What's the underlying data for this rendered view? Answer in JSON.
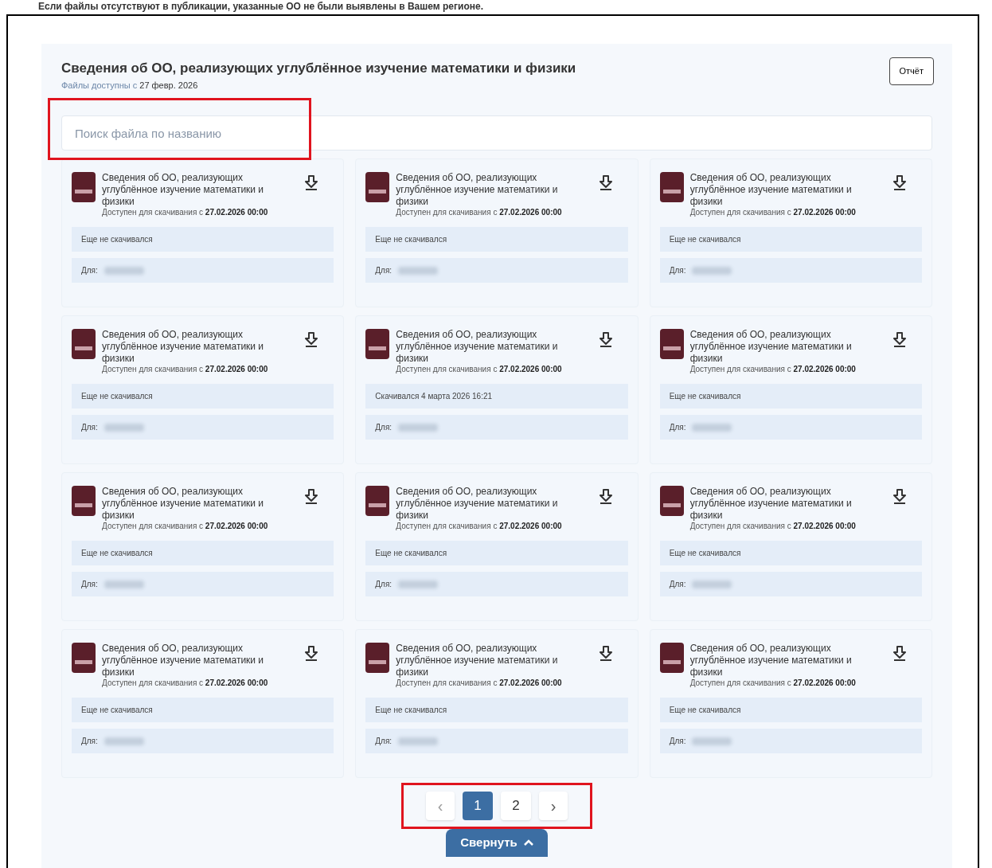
{
  "notice": "Если файлы отсутствуют в публикации, указанные ОО не были выявлены в Вашем регионе.",
  "section": {
    "title": "Сведения об ОО, реализующих углублённое изучение математики и физики",
    "subtitle_label": "Файлы доступны с",
    "subtitle_date": "27 февр. 2026",
    "report_button": "Отчёт"
  },
  "search": {
    "placeholder": "Поиск файла по названию",
    "highlighted": true
  },
  "files": [
    {
      "title": "Сведения об ОО, реализующих углублённое изучение математики и физики",
      "available_label": "Доступен для скачивания с",
      "available_date": "27.02.2026 00:00",
      "status": "Еще не скачивался",
      "for_label": "Для:"
    },
    {
      "title": "Сведения об ОО, реализующих углублённое изучение математики и физики",
      "available_label": "Доступен для скачивания с",
      "available_date": "27.02.2026 00:00",
      "status": "Еще не скачивался",
      "for_label": "Для:"
    },
    {
      "title": "Сведения об ОО, реализующих углублённое изучение математики и физики",
      "available_label": "Доступен для скачивания с",
      "available_date": "27.02.2026 00:00",
      "status": "Еще не скачивался",
      "for_label": "Для:"
    },
    {
      "title": "Сведения об ОО, реализующих углублённое изучение математики и физики",
      "available_label": "Доступен для скачивания с",
      "available_date": "27.02.2026 00:00",
      "status": "Еще не скачивался",
      "for_label": "Для:"
    },
    {
      "title": "Сведения об ОО, реализующих углублённое изучение математики и физики",
      "available_label": "Доступен для скачивания с",
      "available_date": "27.02.2026 00:00",
      "status": "Скачивался 4 марта 2026 16:21",
      "for_label": "Для:"
    },
    {
      "title": "Сведения об ОО, реализующих углублённое изучение математики и физики",
      "available_label": "Доступен для скачивания с",
      "available_date": "27.02.2026 00:00",
      "status": "Еще не скачивался",
      "for_label": "Для:"
    },
    {
      "title": "Сведения об ОО, реализующих углублённое изучение математики и физики",
      "available_label": "Доступен для скачивания с",
      "available_date": "27.02.2026 00:00",
      "status": "Еще не скачивался",
      "for_label": "Для:"
    },
    {
      "title": "Сведения об ОО, реализующих углублённое изучение математики и физики",
      "available_label": "Доступен для скачивания с",
      "available_date": "27.02.2026 00:00",
      "status": "Еще не скачивался",
      "for_label": "Для:"
    },
    {
      "title": "Сведения об ОО, реализующих углублённое изучение математики и физики",
      "available_label": "Доступен для скачивания с",
      "available_date": "27.02.2026 00:00",
      "status": "Еще не скачивался",
      "for_label": "Для:"
    },
    {
      "title": "Сведения об ОО, реализующих углублённое изучение математики и физики",
      "available_label": "Доступен для скачивания с",
      "available_date": "27.02.2026 00:00",
      "status": "Еще не скачивался",
      "for_label": "Для:"
    },
    {
      "title": "Сведения об ОО, реализующих углублённое изучение математики и физики",
      "available_label": "Доступен для скачивания с",
      "available_date": "27.02.2026 00:00",
      "status": "Еще не скачивался",
      "for_label": "Для:"
    },
    {
      "title": "Сведения об ОО, реализующих углублённое изучение математики и физики",
      "available_label": "Доступен для скачивания с",
      "available_date": "27.02.2026 00:00",
      "status": "Еще не скачивался",
      "for_label": "Для:"
    }
  ],
  "pagination": {
    "highlighted": true,
    "prev": "‹",
    "next": "›",
    "pages": [
      {
        "label": "1",
        "selected": true
      },
      {
        "label": "2",
        "selected": false
      }
    ]
  },
  "collapse_button": "Свернуть"
}
